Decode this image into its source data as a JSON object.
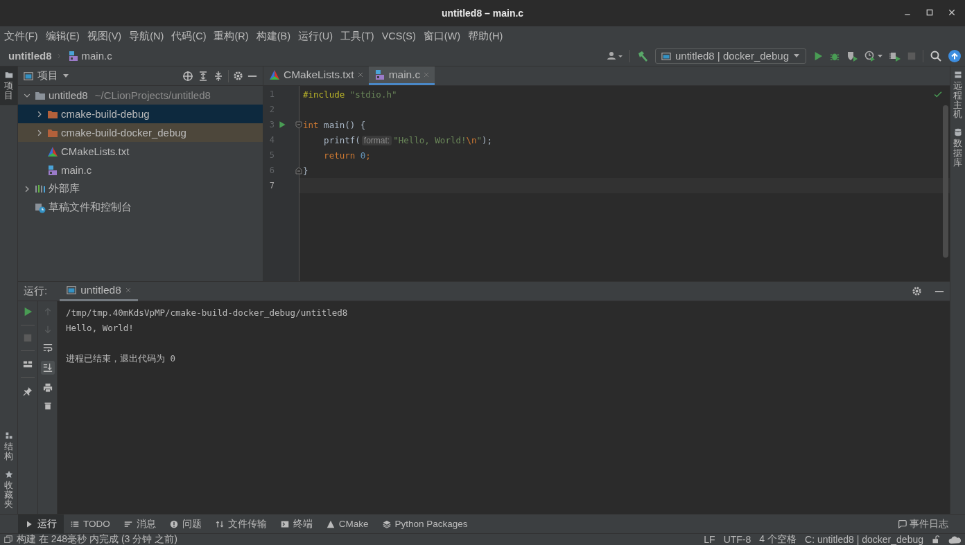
{
  "window": {
    "title": "untitled8 – main.c"
  },
  "menu": [
    {
      "label": "文件(F)"
    },
    {
      "label": "编辑(E)"
    },
    {
      "label": "视图(V)"
    },
    {
      "label": "导航(N)"
    },
    {
      "label": "代码(C)"
    },
    {
      "label": "重构(R)"
    },
    {
      "label": "构建(B)"
    },
    {
      "label": "运行(U)"
    },
    {
      "label": "工具(T)"
    },
    {
      "label": "VCS(S)"
    },
    {
      "label": "窗口(W)"
    },
    {
      "label": "帮助(H)"
    }
  ],
  "breadcrumb": [
    {
      "label": "untitled8",
      "kind": "project"
    },
    {
      "label": "main.c",
      "kind": "c-file"
    }
  ],
  "toolbar": {
    "run_config": "untitled8 | docker_debug"
  },
  "tool_windows": {
    "left_top": [
      {
        "label": "项目",
        "kind": "folder",
        "selected": true
      }
    ],
    "left_bottom": [
      {
        "label": "结构",
        "kind": "structure",
        "selected": false
      },
      {
        "label": "收藏夹",
        "kind": "star",
        "selected": false
      }
    ],
    "right": [
      {
        "label": "远程主机",
        "kind": "remote",
        "selected": false
      },
      {
        "label": "数据库",
        "kind": "database",
        "selected": false
      }
    ]
  },
  "project_panel": {
    "title": "项目",
    "tree": [
      {
        "label": "untitled8",
        "path": "~/CLionProjects/untitled8",
        "kind": "project-folder",
        "expanded": true,
        "selected": false,
        "highlighted": false,
        "children": [
          {
            "label": "cmake-build-debug",
            "kind": "build-folder",
            "expanded": false,
            "selected": true,
            "highlighted": false
          },
          {
            "label": "cmake-build-docker_debug",
            "kind": "build-folder",
            "expanded": false,
            "selected": false,
            "highlighted": true
          },
          {
            "label": "CMakeLists.txt",
            "kind": "cmake",
            "selected": false,
            "highlighted": false
          },
          {
            "label": "main.c",
            "kind": "c-file",
            "selected": false,
            "highlighted": false
          }
        ]
      },
      {
        "label": "外部库",
        "kind": "library",
        "expanded": false,
        "selected": false,
        "highlighted": false
      },
      {
        "label": "草稿文件和控制台",
        "kind": "scratches",
        "selected": false,
        "highlighted": false
      }
    ]
  },
  "editor": {
    "tabs": [
      {
        "label": "CMakeLists.txt",
        "kind": "cmake",
        "selected": false
      },
      {
        "label": "main.c",
        "kind": "c-file",
        "selected": true
      }
    ],
    "lines": [
      {
        "number": "1",
        "kind": "plain",
        "current": false,
        "run": false,
        "tokens": [
          {
            "text": "#include",
            "kind": "preproc"
          },
          {
            "text": " \"stdio.h\"",
            "kind": "string"
          }
        ]
      },
      {
        "number": "2",
        "kind": "plain",
        "current": false,
        "run": false
      },
      {
        "number": "3",
        "kind": "fold-start",
        "current": false,
        "run": true,
        "tokens": [
          {
            "text": "int",
            "kind": "keyword"
          },
          {
            "text": " main() {",
            "kind": "plain"
          }
        ]
      },
      {
        "number": "4",
        "kind": "plain",
        "current": false,
        "run": false,
        "tokens": [
          {
            "text": "    printf(",
            "kind": "plain"
          },
          {
            "text": "format:",
            "kind": "hint"
          },
          {
            "text": "\"Hello, World!",
            "kind": "string"
          },
          {
            "text": "\\n",
            "kind": "escape"
          },
          {
            "text": "\"",
            "kind": "string"
          },
          {
            "text": ");",
            "kind": "plain"
          }
        ]
      },
      {
        "number": "5",
        "kind": "plain",
        "current": false,
        "run": false,
        "tokens": [
          {
            "text": "    return",
            "kind": "keyword"
          },
          {
            "text": " 0",
            "kind": "number"
          },
          {
            "text": ";",
            "kind": "keyword"
          }
        ]
      },
      {
        "number": "6",
        "kind": "fold-end",
        "current": false,
        "run": false,
        "tokens": [
          {
            "text": "}",
            "kind": "plain"
          }
        ]
      },
      {
        "number": "7",
        "kind": "plain",
        "current": true,
        "run": false
      }
    ]
  },
  "run_panel": {
    "label": "运行:",
    "tabs": [
      {
        "label": "untitled8",
        "selected": true
      }
    ],
    "output": [
      "/tmp/tmp.40mKdsVpMP/cmake-build-docker_debug/untitled8",
      "Hello, World!"
    ],
    "exit_message": "进程已结束，退出代码为 0"
  },
  "bottom_tabs": [
    {
      "label": "运行",
      "kind": "run",
      "selected": true
    },
    {
      "label": "TODO",
      "kind": "todo",
      "selected": false
    },
    {
      "label": "消息",
      "kind": "messages",
      "selected": false
    },
    {
      "label": "问题",
      "kind": "problems",
      "selected": false
    },
    {
      "label": "文件传输",
      "kind": "transfer",
      "selected": false
    },
    {
      "label": "终端",
      "kind": "terminal",
      "selected": false
    },
    {
      "label": "CMake",
      "kind": "cmake",
      "selected": false
    },
    {
      "label": "Python Packages",
      "kind": "packages",
      "selected": false
    }
  ],
  "event_log": "事件日志",
  "status_bar": {
    "message": "构建 在 248毫秒 内完成 (3 分钟 之前)",
    "items": [
      "LF",
      "UTF-8",
      "4 个空格",
      "C: untitled8 | docker_debug"
    ]
  }
}
